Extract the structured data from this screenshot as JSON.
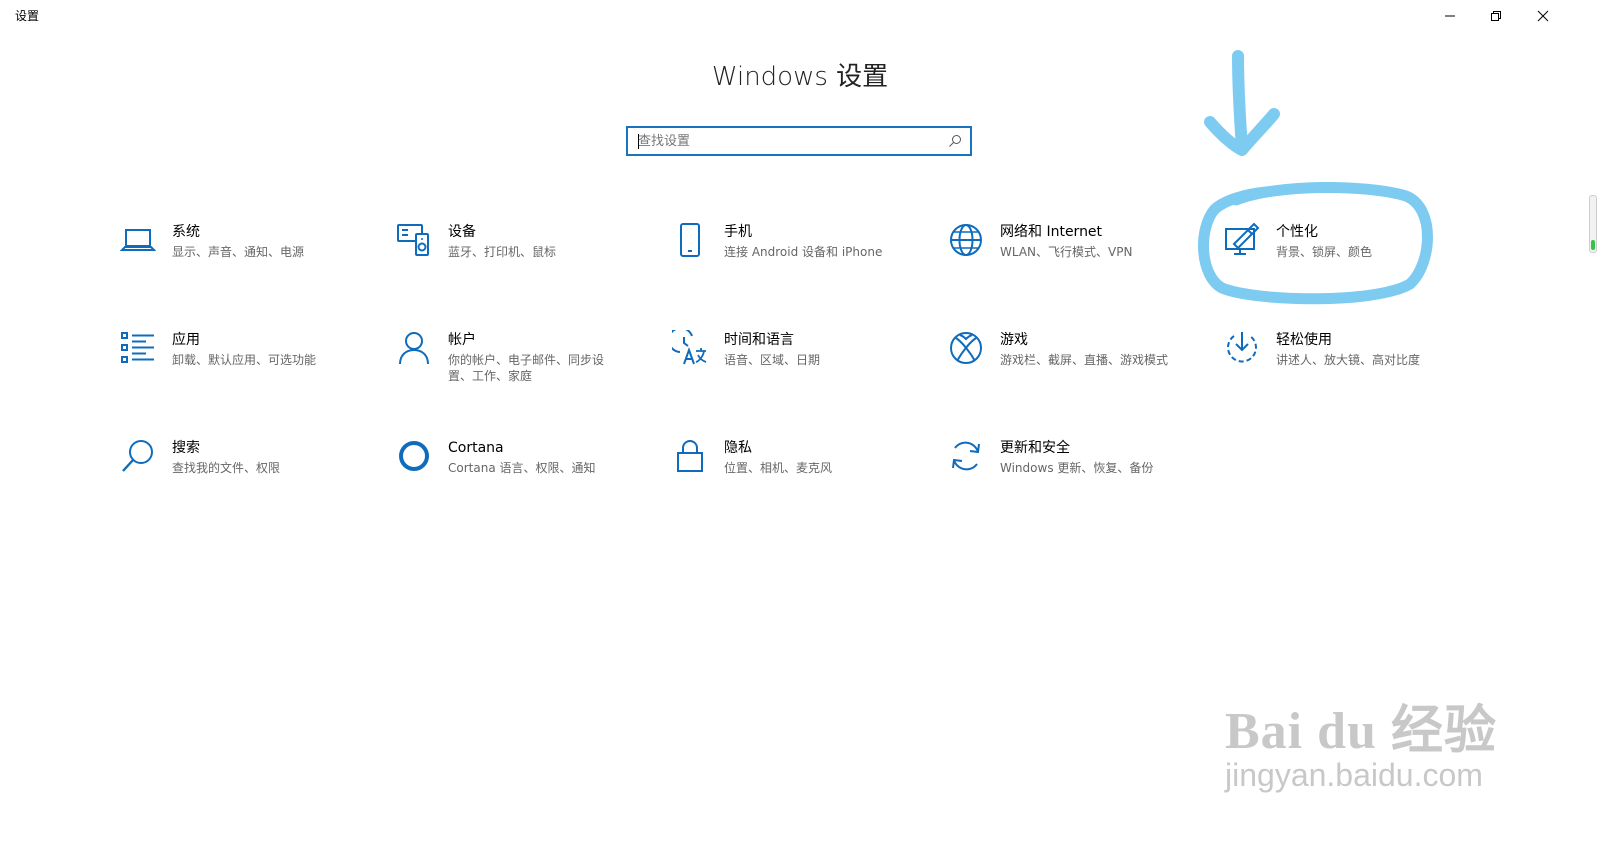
{
  "window": {
    "title": "设置",
    "buttons": {
      "minimize": "minimize-icon",
      "restore": "restore-icon",
      "close": "close-icon"
    }
  },
  "header": {
    "title": "Windows 设置"
  },
  "search": {
    "placeholder": "查找设置",
    "value": ""
  },
  "tiles": [
    {
      "title": "系统",
      "desc": "显示、声音、通知、电源",
      "icon": "laptop-icon"
    },
    {
      "title": "设备",
      "desc": "蓝牙、打印机、鼠标",
      "icon": "devices-icon"
    },
    {
      "title": "手机",
      "desc": "连接 Android 设备和 iPhone",
      "icon": "phone-icon"
    },
    {
      "title": "网络和 Internet",
      "desc": "WLAN、飞行模式、VPN",
      "icon": "globe-icon"
    },
    {
      "title": "个性化",
      "desc": "背景、锁屏、颜色",
      "icon": "personalization-icon"
    },
    {
      "title": "应用",
      "desc": "卸载、默认应用、可选功能",
      "icon": "apps-list-icon"
    },
    {
      "title": "帐户",
      "desc": "你的帐户、电子邮件、同步设置、工作、家庭",
      "icon": "person-icon"
    },
    {
      "title": "时间和语言",
      "desc": "语音、区域、日期",
      "icon": "time-language-icon"
    },
    {
      "title": "游戏",
      "desc": "游戏栏、截屏、直播、游戏模式",
      "icon": "xbox-icon"
    },
    {
      "title": "轻松使用",
      "desc": "讲述人、放大镜、高对比度",
      "icon": "ease-of-access-icon"
    },
    {
      "title": "搜索",
      "desc": "查找我的文件、权限",
      "icon": "search-magnifier-icon"
    },
    {
      "title": "Cortana",
      "desc": "Cortana 语言、权限、通知",
      "icon": "cortana-icon"
    },
    {
      "title": "隐私",
      "desc": "位置、相机、麦克风",
      "icon": "lock-icon"
    },
    {
      "title": "更新和安全",
      "desc": "Windows 更新、恢复、备份",
      "icon": "refresh-icon"
    }
  ],
  "annotation": {
    "color": "#7ecbf2",
    "target": "个性化"
  },
  "colors": {
    "accent": "#0f6cbd",
    "scroll_thumb": "#35c24a"
  },
  "watermark": {
    "brand": "Bai du 经验",
    "url": "jingyan.baidu.com"
  }
}
